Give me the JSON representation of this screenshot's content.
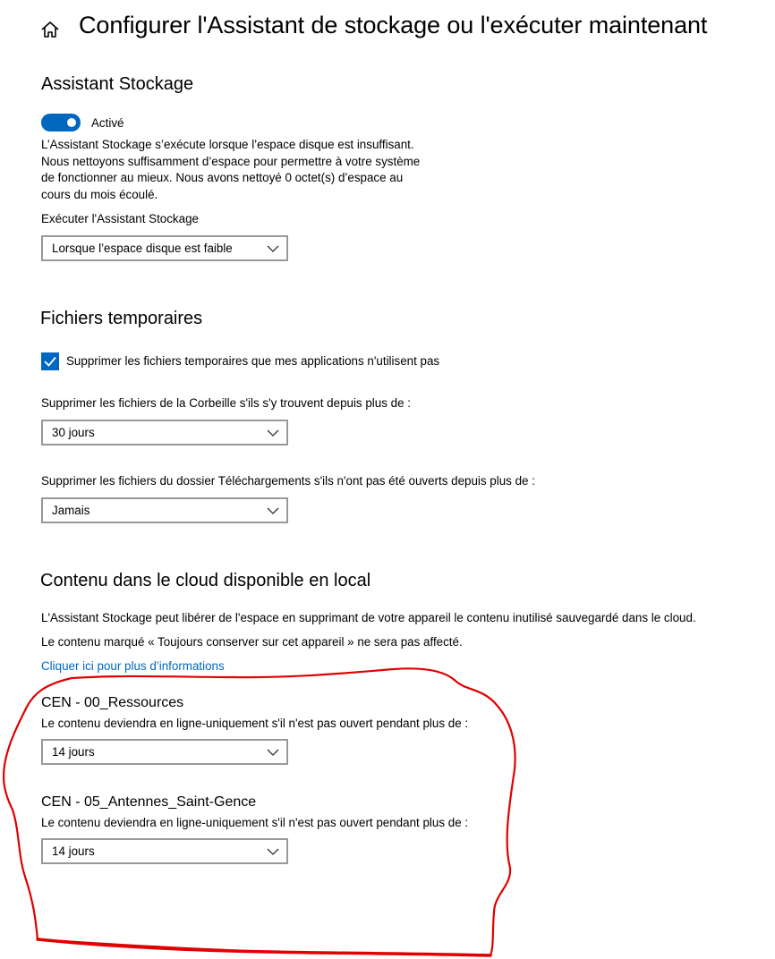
{
  "header": {
    "home_icon": "home-icon",
    "title": "Configurer l'Assistant de stockage ou l'exécuter maintenant"
  },
  "storage_sense": {
    "heading": "Assistant Stockage",
    "toggle_state": "on",
    "toggle_label": "Activé",
    "description_lines": [
      "L’Assistant Stockage s’exécute lorsque l’espace disque est insuffisant.",
      "Nous nettoyons suffisamment d’espace pour permettre à votre système",
      "de fonctionner au mieux. Nous avons nettoyé 0 octet(s) d’espace au",
      "cours du mois écoulé."
    ],
    "run_label": "Exécuter l'Assistant Stockage",
    "run_value": "Lorsque l’espace disque est faible"
  },
  "temp_files": {
    "heading": "Fichiers temporaires",
    "checkbox_checked": true,
    "checkbox_label": "Supprimer les fichiers temporaires que mes applications n'utilisent pas",
    "recycle_label": "Supprimer les fichiers de la Corbeille s'ils s'y trouvent depuis plus de :",
    "recycle_value": "30 jours",
    "downloads_label": "Supprimer les fichiers du dossier Téléchargements s'ils n'ont pas été ouverts depuis plus de :",
    "downloads_value": "Jamais"
  },
  "cloud": {
    "heading": "Contenu dans le cloud disponible en local",
    "desc1": "L'Assistant Stockage peut libérer de l'espace en supprimant de votre appareil le contenu inutilisé sauvegardé dans le cloud.",
    "desc2": "Le contenu marqué « Toujours conserver sur cet appareil » ne sera pas affecté.",
    "link": "Cliquer ici pour plus d’informations",
    "accounts": [
      {
        "name": "CEN - 00_Ressources",
        "label": "Le contenu deviendra en ligne-uniquement s'il n'est pas ouvert pendant plus de :",
        "value": "14 jours"
      },
      {
        "name": "CEN - 05_Antennes_Saint-Gence",
        "label": "Le contenu deviendra en ligne-uniquement s'il n'est pas ouvert pendant plus de :",
        "value": "14 jours"
      }
    ]
  },
  "colors": {
    "accent": "#0067c0",
    "annotation": "#e00000",
    "dropdown_border": "#999999"
  }
}
